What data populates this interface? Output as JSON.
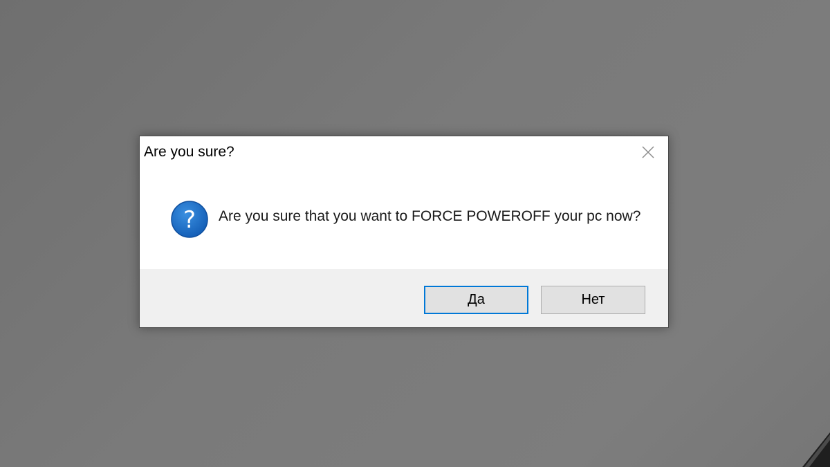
{
  "dialog": {
    "title": "Are you sure?",
    "message": "Are you sure that you want to FORCE POWEROFF your pc now?",
    "icon": "question-icon",
    "close_icon": "close-icon",
    "buttons": {
      "yes_label": "Да",
      "no_label": "Нет"
    },
    "focused_button": "yes"
  },
  "colors": {
    "desktop": "#767676",
    "accent_focus": "#0078d7",
    "icon_blue": "#1c6fc6",
    "footer_bg": "#f0f0f0"
  }
}
